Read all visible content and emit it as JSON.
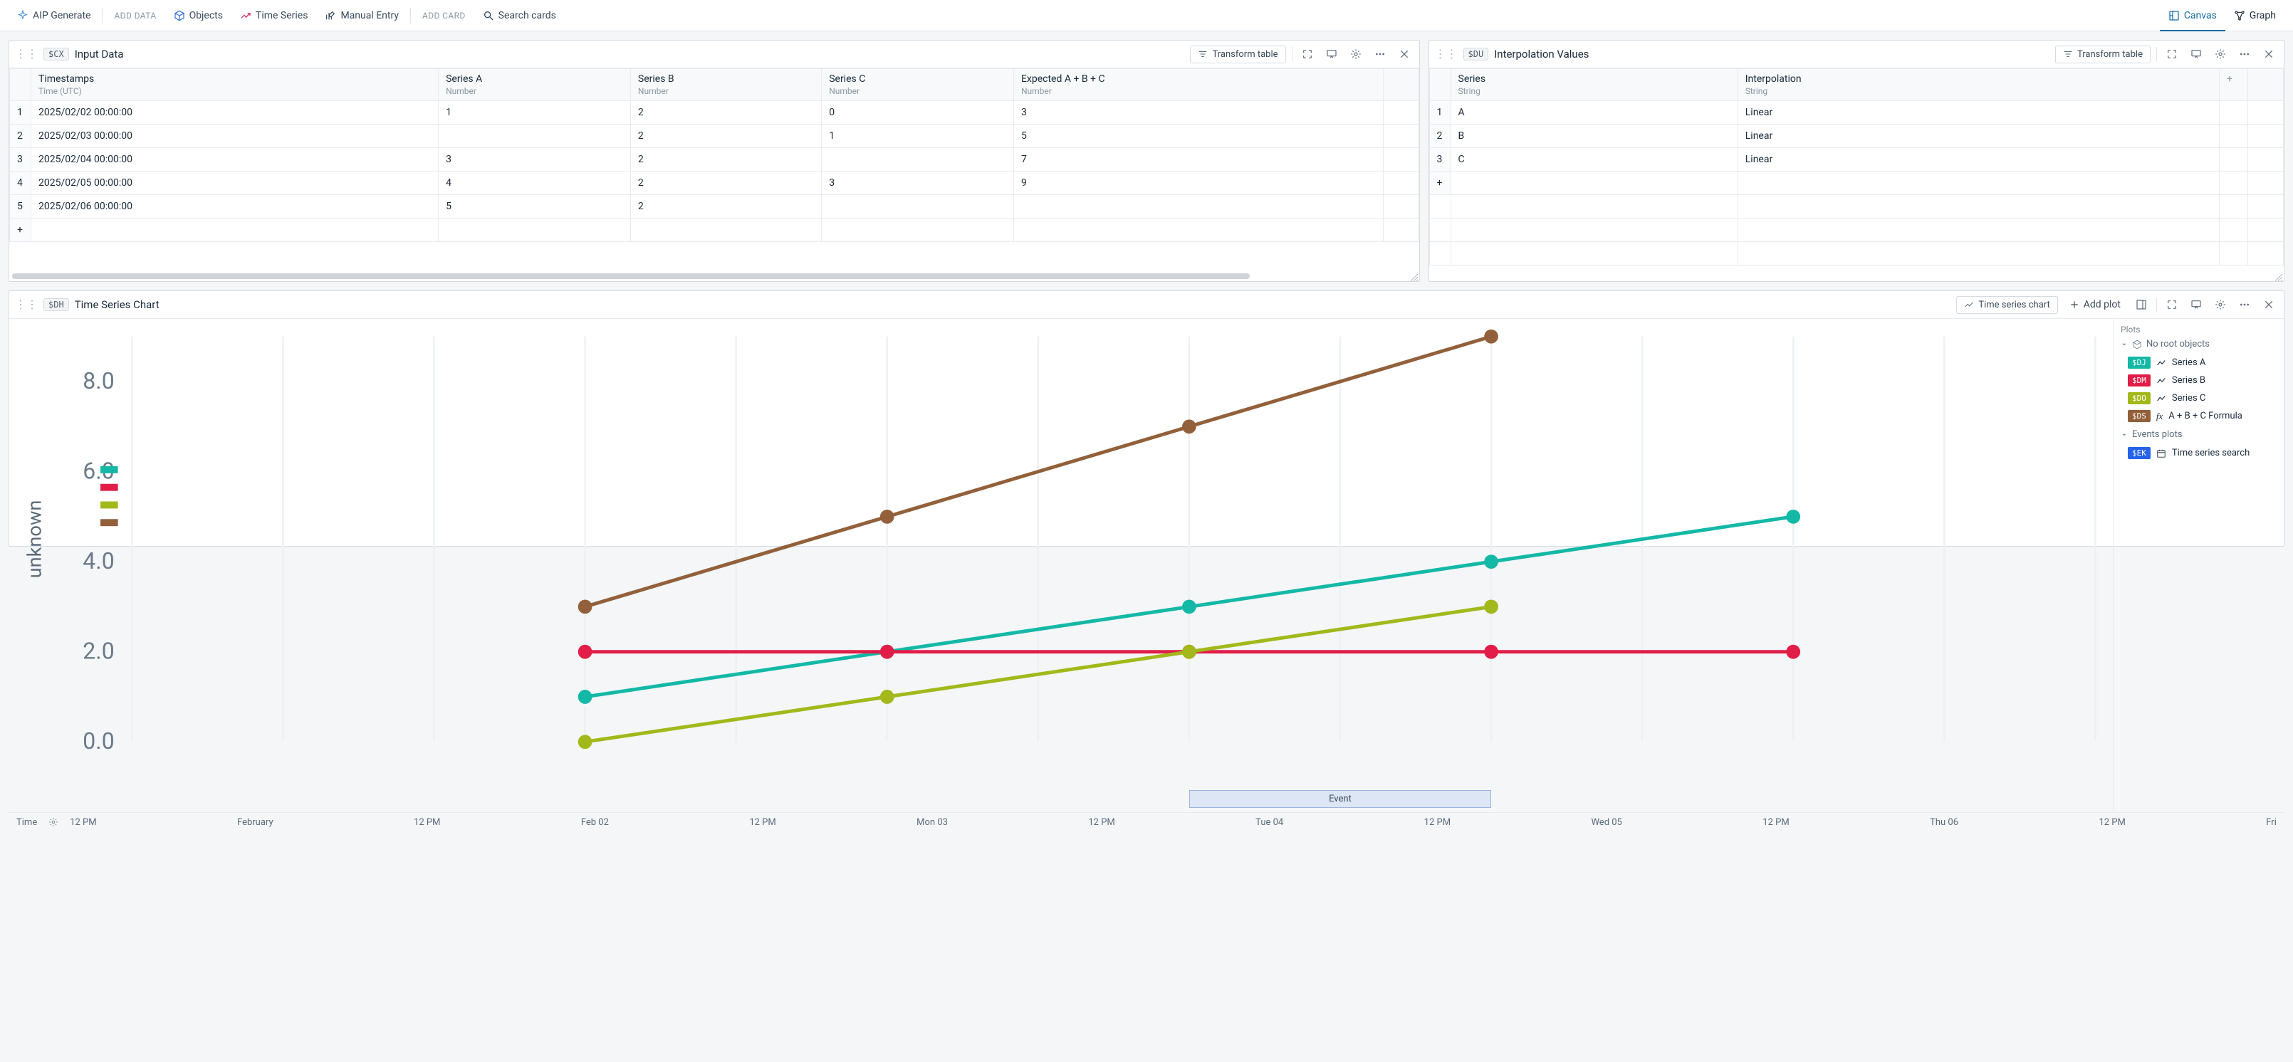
{
  "topbar": {
    "aip_generate": "AIP Generate",
    "add_data_label": "ADD DATA",
    "objects": "Objects",
    "time_series": "Time Series",
    "manual_entry": "Manual Entry",
    "add_card_label": "ADD CARD",
    "search_placeholder": "Search cards",
    "canvas": "Canvas",
    "graph": "Graph"
  },
  "input_card": {
    "tag": "$CX",
    "title": "Input Data",
    "transform_btn": "Transform table",
    "columns": [
      {
        "name": "Timestamps",
        "type": "Time (UTC)"
      },
      {
        "name": "Series A",
        "type": "Number"
      },
      {
        "name": "Series B",
        "type": "Number"
      },
      {
        "name": "Series C",
        "type": "Number"
      },
      {
        "name": "Expected A + B + C",
        "type": "Number"
      }
    ],
    "rows": [
      [
        "2025/02/02 00:00:00",
        "1",
        "2",
        "0",
        "3"
      ],
      [
        "2025/02/03 00:00:00",
        "",
        "2",
        "1",
        "5"
      ],
      [
        "2025/02/04 00:00:00",
        "3",
        "2",
        "",
        "7"
      ],
      [
        "2025/02/05 00:00:00",
        "4",
        "2",
        "3",
        "9"
      ],
      [
        "2025/02/06 00:00:00",
        "5",
        "2",
        "",
        ""
      ]
    ]
  },
  "interp_card": {
    "tag": "$DU",
    "title": "Interpolation Values",
    "transform_btn": "Transform table",
    "columns": [
      {
        "name": "Series",
        "type": "String"
      },
      {
        "name": "Interpolation",
        "type": "String"
      }
    ],
    "rows": [
      [
        "A",
        "Linear"
      ],
      [
        "B",
        "Linear"
      ],
      [
        "C",
        "Linear"
      ]
    ]
  },
  "chart_card": {
    "tag": "$DH",
    "title": "Time Series Chart",
    "chart_btn": "Time series chart",
    "add_plot": "Add plot",
    "plots_heading": "Plots",
    "no_root_label": "No root objects",
    "events_plots_label": "Events plots",
    "legend": [
      {
        "tag": "$DJ",
        "color": "#14b8a6",
        "label": "Series A",
        "icon": "line"
      },
      {
        "tag": "$DM",
        "color": "#e11d48",
        "label": "Series B",
        "icon": "line"
      },
      {
        "tag": "$DO",
        "color": "#a3b81a",
        "label": "Series C",
        "icon": "line"
      },
      {
        "tag": "$DS",
        "color": "#92603a",
        "label": "A + B + C Formula",
        "icon": "fx"
      }
    ],
    "events_legend": {
      "tag": "$EK",
      "color": "#2563eb",
      "label": "Time series search",
      "icon": "calendar"
    },
    "event_marker_label": "Event",
    "y_axis_label": "unknown",
    "time_label": "Time",
    "x_ticks": [
      "12 PM",
      "February",
      "12 PM",
      "Feb 02",
      "12 PM",
      "Mon 03",
      "12 PM",
      "Tue 04",
      "12 PM",
      "Wed 05",
      "12 PM",
      "Thu 06",
      "12 PM",
      "Fri"
    ]
  },
  "chart_data": {
    "type": "line",
    "xlabel": "Time",
    "ylabel": "unknown",
    "ylim": [
      0,
      9
    ],
    "y_ticks": [
      0.0,
      2.0,
      4.0,
      6.0,
      8.0
    ],
    "x_categories": [
      "Feb 02",
      "Mon 03",
      "Tue 04",
      "Wed 05",
      "Thu 06"
    ],
    "series": [
      {
        "name": "Series A",
        "color": "#14b8a6",
        "values": [
          1,
          2,
          3,
          4,
          5
        ]
      },
      {
        "name": "Series B",
        "color": "#e11d48",
        "values": [
          2,
          2,
          2,
          2,
          2
        ]
      },
      {
        "name": "Series C",
        "color": "#a3b81a",
        "values": [
          0,
          1,
          2,
          3,
          null
        ]
      },
      {
        "name": "A + B + C Formula",
        "color": "#92603a",
        "values": [
          3,
          5,
          7,
          9,
          null
        ]
      }
    ],
    "event_range": {
      "label": "Event",
      "from": "Tue 04",
      "to": "Wed 05"
    }
  }
}
